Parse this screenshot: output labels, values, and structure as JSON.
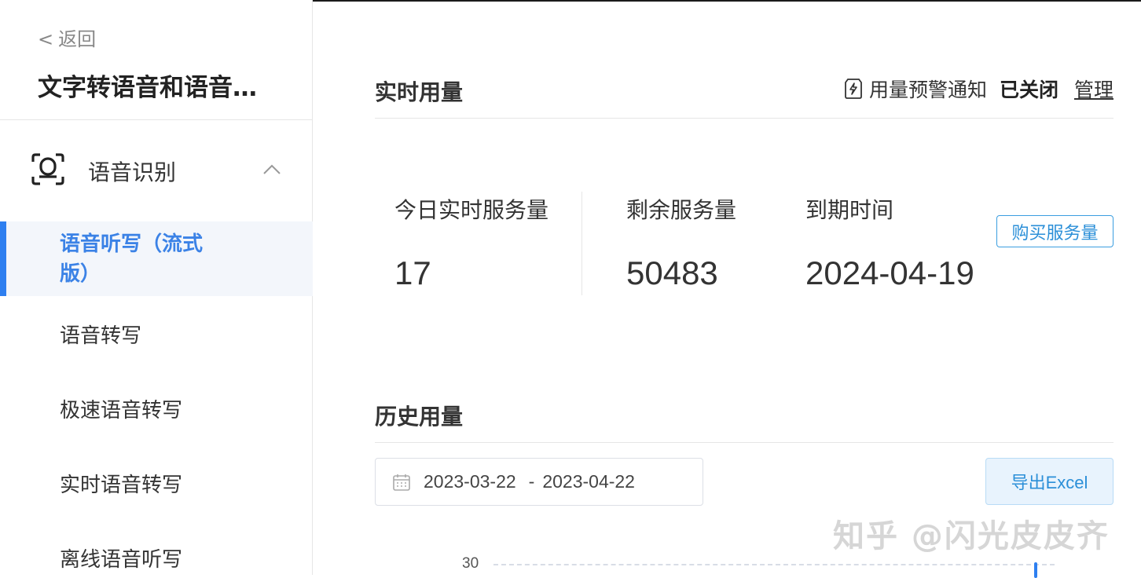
{
  "sidebar": {
    "back_label": "返回",
    "product_title": "文字转语音和语音识别",
    "group": {
      "label": "语音识别",
      "icon": "voice-recognition-icon",
      "expanded": true
    },
    "items": [
      {
        "label": "语音听写（流式版）",
        "active": true
      },
      {
        "label": "语音转写",
        "active": false
      },
      {
        "label": "极速语音转写",
        "active": false
      },
      {
        "label": "实时语音转写",
        "active": false
      },
      {
        "label": "离线语音听写",
        "active": false
      }
    ]
  },
  "realtime": {
    "title": "实时用量",
    "alert_label": "用量预警通知",
    "alert_status": "已关闭",
    "manage_label": "管理",
    "stats": [
      {
        "label": "今日实时服务量",
        "value": "17"
      },
      {
        "label": "剩余服务量",
        "value": "50483"
      },
      {
        "label": "到期时间",
        "value": "2024-04-19"
      }
    ],
    "buy_label": "购买服务量"
  },
  "history": {
    "title": "历史用量",
    "date_start": "2023-03-22",
    "date_end": "2023-04-22",
    "date_separator": "-",
    "export_label": "导出Excel",
    "chart_data": {
      "type": "line",
      "y_ticks": [
        "30"
      ]
    }
  },
  "watermark": "知乎 @闪光皮皮齐",
  "colors": {
    "accent": "#2e7ff0",
    "link": "#2b8fd8",
    "active_bg": "#f3f6fb"
  }
}
